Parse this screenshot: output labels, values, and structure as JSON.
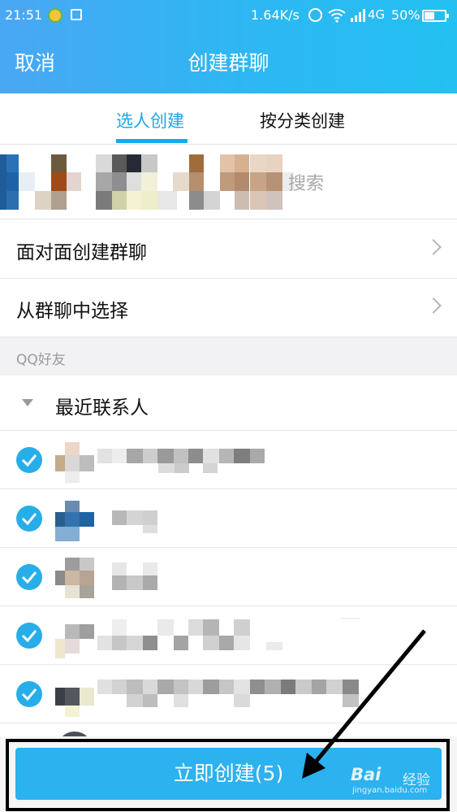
{
  "status_bar": {
    "time": "21:51",
    "net_speed": "1.64K/s",
    "network": "4G",
    "battery": "50%"
  },
  "header": {
    "cancel_label": "取消",
    "title": "创建群聊"
  },
  "tabs": [
    {
      "label": "选人创建",
      "active": true
    },
    {
      "label": "按分类创建",
      "active": false
    }
  ],
  "search": {
    "placeholder": "搜索"
  },
  "menu": [
    {
      "label": "面对面创建群聊"
    },
    {
      "label": "从群聊中选择"
    }
  ],
  "section": {
    "label": "QQ好友"
  },
  "group": {
    "label": "最近联系人"
  },
  "contacts_checked": [
    true,
    true,
    true,
    true,
    true
  ],
  "create_button": {
    "label": "立即创建(5)"
  },
  "watermark": {
    "logo": "Bai",
    "text": "经验",
    "url": "jingyan.baidu.com"
  },
  "colors": {
    "accent": "#1da7e8",
    "button": "#2cb2ee",
    "header_start": "#4aa7f4",
    "header_end": "#23c0f1"
  }
}
